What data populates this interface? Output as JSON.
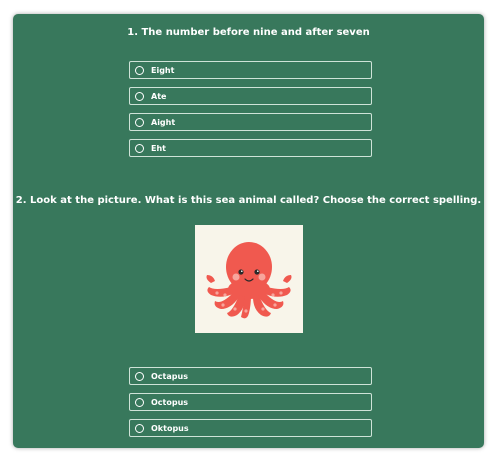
{
  "colors": {
    "card_background": "#38785c",
    "text": "#ffffff",
    "octopus": "#f0594f"
  },
  "questions": [
    {
      "text": "1. The number before nine and after seven",
      "options": [
        "Eight",
        "Ate",
        "Aight",
        "Eht"
      ]
    },
    {
      "text": "2. Look at the picture. What is this sea animal called? Choose the correct spelling.",
      "image_icon": "octopus-illustration",
      "options": [
        "Octapus",
        "Octopus",
        "Oktopus"
      ]
    }
  ]
}
